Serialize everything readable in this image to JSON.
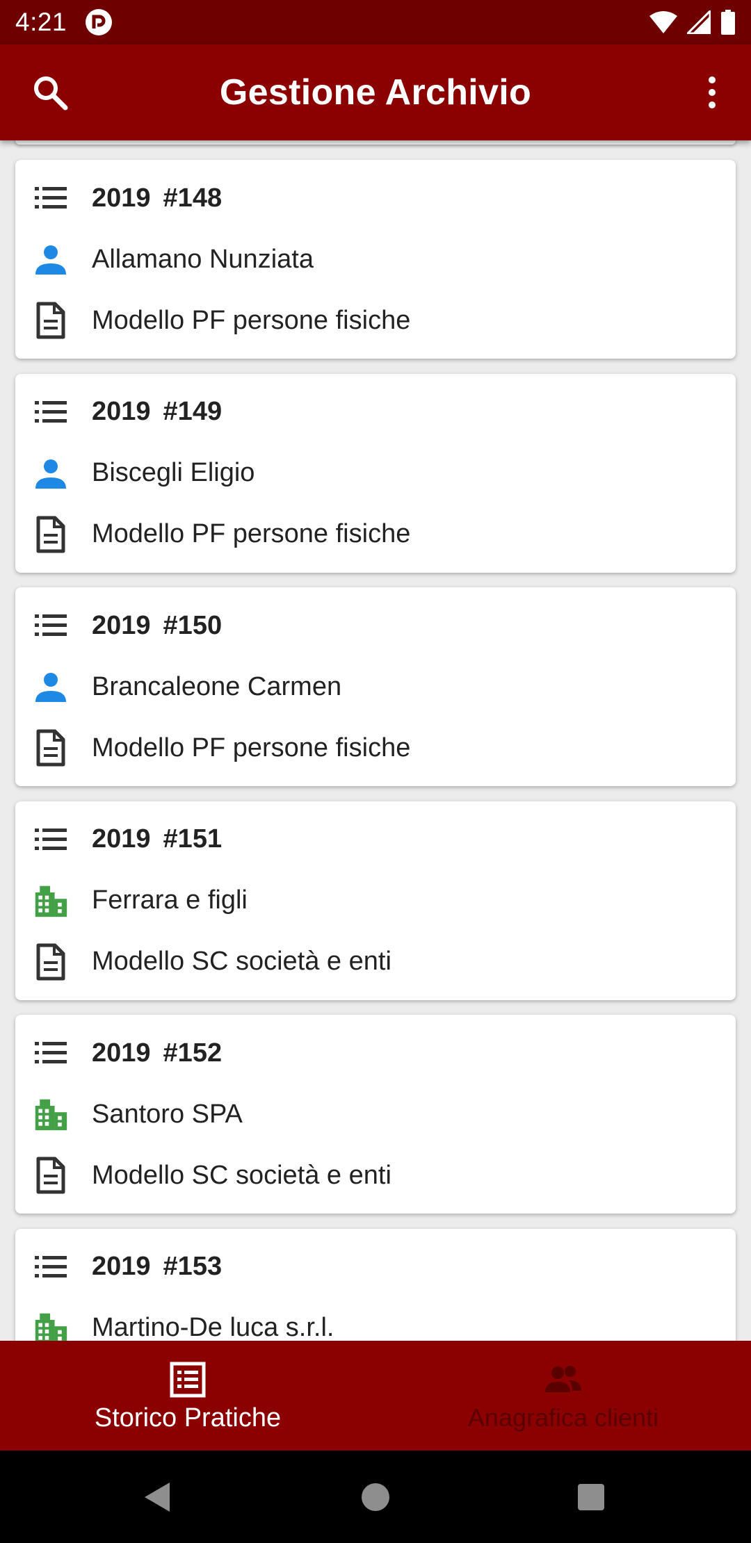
{
  "status_bar": {
    "time": "4:21"
  },
  "app_bar": {
    "title": "Gestione Archivio"
  },
  "colors": {
    "primary": "#8b0000",
    "status_bar": "#6e0000",
    "person_icon": "#1e88e5",
    "company_icon": "#43a047",
    "nav_inactive": "#5a0000"
  },
  "cards": [
    {
      "year": "2019",
      "number": "#148",
      "client": "Allamano Nunziata",
      "client_type": "person",
      "model": "Modello PF persone fisiche"
    },
    {
      "year": "2019",
      "number": "#149",
      "client": "Biscegli Eligio",
      "client_type": "person",
      "model": "Modello PF persone fisiche"
    },
    {
      "year": "2019",
      "number": "#150",
      "client": "Brancaleone Carmen",
      "client_type": "person",
      "model": "Modello PF persone fisiche"
    },
    {
      "year": "2019",
      "number": "#151",
      "client": "Ferrara e figli",
      "client_type": "company",
      "model": "Modello SC società e enti"
    },
    {
      "year": "2019",
      "number": "#152",
      "client": "Santoro SPA",
      "client_type": "company",
      "model": "Modello SC società e enti"
    },
    {
      "year": "2019",
      "number": "#153",
      "client": "Martino-De luca s.r.l.",
      "client_type": "company",
      "model": ""
    }
  ],
  "bottom_nav": {
    "items": [
      {
        "label": "Storico Pratiche",
        "icon": "list-alt-icon",
        "active": true
      },
      {
        "label": "Anagrafica clienti",
        "icon": "people-icon",
        "active": false
      }
    ]
  }
}
